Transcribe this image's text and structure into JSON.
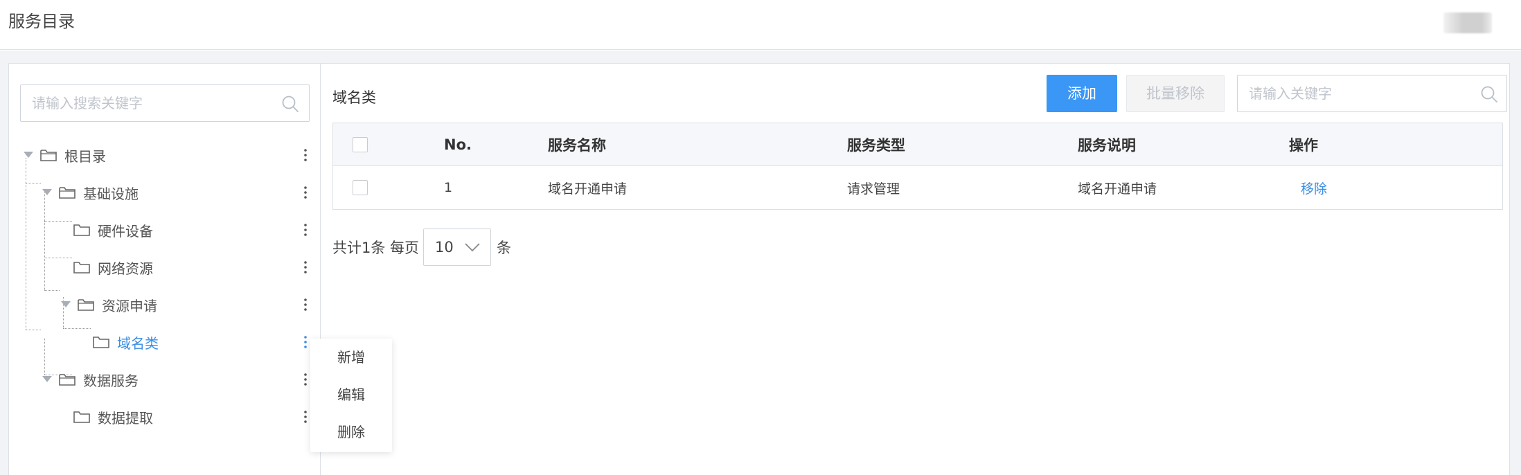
{
  "header": {
    "title": "服务目录"
  },
  "sidebar": {
    "search_placeholder": "请输入搜索关键字",
    "tree": {
      "root": "根目录",
      "infra": "基础设施",
      "hardware": "硬件设备",
      "network": "网络资源",
      "resource_request": "资源申请",
      "domain": "域名类",
      "data_service": "数据服务",
      "data_extract": "数据提取"
    },
    "context_menu": {
      "add": "新增",
      "edit": "编辑",
      "delete": "删除"
    }
  },
  "main": {
    "title": "域名类",
    "add_button": "添加",
    "batch_remove_button": "批量移除",
    "keyword_placeholder": "请输入关键字",
    "table": {
      "headers": {
        "no": "No.",
        "name": "服务名称",
        "type": "服务类型",
        "desc": "服务说明",
        "op": "操作"
      },
      "rows": [
        {
          "no": "1",
          "name": "域名开通申请",
          "type": "请求管理",
          "desc": "域名开通申请",
          "op": "移除"
        }
      ]
    },
    "pager": {
      "total_text": "共计1条 每页",
      "page_size": "10",
      "suffix": "条"
    }
  },
  "colors": {
    "accent": "#3a97f5",
    "link": "#3a8ee6",
    "border": "#dde1e6"
  }
}
